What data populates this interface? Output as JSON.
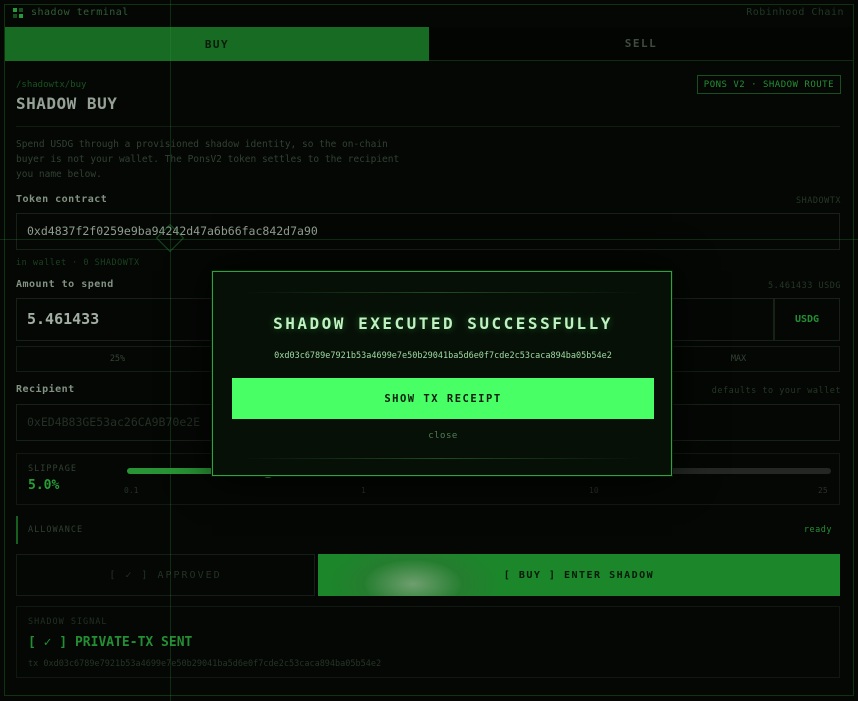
{
  "app": {
    "title": "shadow terminal",
    "chain": "Robinhood Chain"
  },
  "tabs": {
    "buy": "BUY",
    "sell": "SELL"
  },
  "header": {
    "breadcrumb": "/shadowtx/buy",
    "title": "SHADOW BUY",
    "route_badge": "PONS V2 · SHADOW ROUTE",
    "description": "Spend USDG through a provisioned shadow identity, so the on-chain buyer is not your wallet. The PonsV2 token settles to the recipient you name below."
  },
  "token": {
    "label": "Token contract",
    "hint": "SHADOWTX",
    "value": "0xd4837f2f0259e9ba94242d47a6b66fac842d7a90",
    "wallet_info": "in wallet · 0 SHADOWTX"
  },
  "amount": {
    "label": "Amount to spend",
    "balance": "5.461433 USDG",
    "value": "5.461433",
    "unit": "USDG",
    "presets": [
      "25%",
      "MAX"
    ]
  },
  "recipient": {
    "label": "Recipient",
    "hint": "defaults to your wallet",
    "placeholder": "0xED4B83GE53ac26CA9B70e2E"
  },
  "slippage": {
    "label": "SLIPPAGE",
    "value": "5.0%",
    "level": 0.2,
    "ticks": [
      "0.1",
      "1",
      "10",
      "25"
    ]
  },
  "allowance": {
    "label": "ALLOWANCE",
    "state": "ready"
  },
  "actions": {
    "approved": "[ ✓ ] APPROVED",
    "buy": "[ BUY ] ENTER SHADOW"
  },
  "signal": {
    "label": "SHADOW SIGNAL",
    "status": "[ ✓ ] PRIVATE-TX SENT",
    "tx": "tx 0xd03c6789e7921b53a4699e7e50b29041ba5d6e0f7cde2c53caca894ba05b54e2"
  },
  "modal": {
    "title": "SHADOW EXECUTED SUCCESSFULLY",
    "hash": "0xd03c6789e7921b53a4699e7e50b29041ba5d6e0f7cde2c53caca894ba05b54e2",
    "receipt_button": "SHOW TX RECEIPT",
    "close": "close"
  },
  "colors": {
    "accent": "#48ff66",
    "buy_tab": "#1c7a27",
    "background": "#050805"
  }
}
